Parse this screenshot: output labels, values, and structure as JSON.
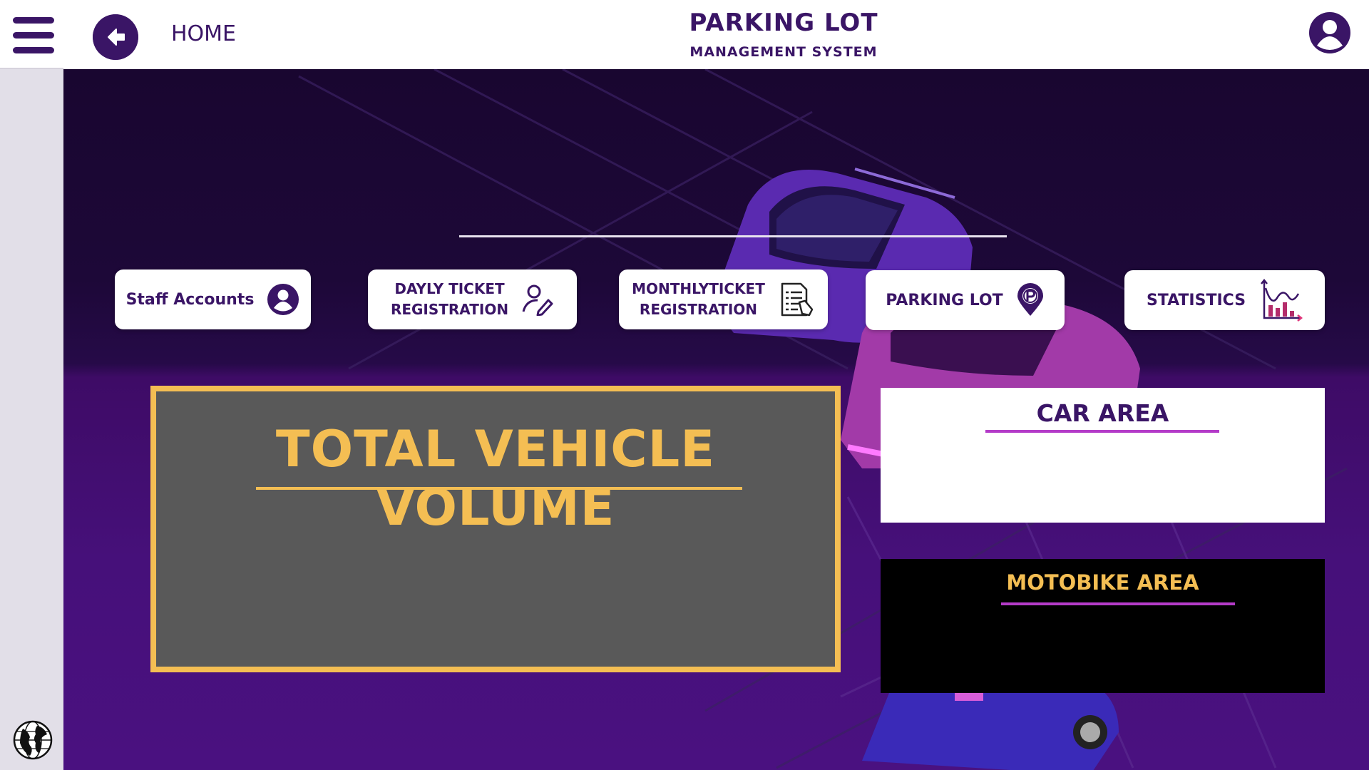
{
  "header": {
    "home_label": "HOME",
    "title": "PARKING LOT",
    "subtitle": "MANAGEMENT SYSTEM"
  },
  "icons": {
    "menu": "hamburger-icon",
    "back": "arrow-left-icon",
    "user": "user-circle-icon",
    "globe": "globe-icon"
  },
  "nav": [
    {
      "label": "Staff Accounts",
      "icon": "user-circle-icon"
    },
    {
      "label_line1": "DAYLY TICKET",
      "label_line2": "REGISTRATION",
      "icon": "user-edit-icon"
    },
    {
      "label_line1": "MONTHLYTICKET",
      "label_line2": "REGISTRATION",
      "icon": "document-list-icon"
    },
    {
      "label": "PARKING LOT",
      "icon": "parking-pin-icon"
    },
    {
      "label": "STATISTICS",
      "icon": "chart-icon"
    }
  ],
  "panels": {
    "total_title": "TOTAL VEHICLE VOLUME",
    "car_title": "CAR AREA",
    "moto_title": "MOTOBIKE AREA"
  },
  "colors": {
    "primary": "#3a1566",
    "accent_gold": "#f4be53",
    "accent_magenta": "#b43bc8",
    "panel_gray": "#595959"
  }
}
